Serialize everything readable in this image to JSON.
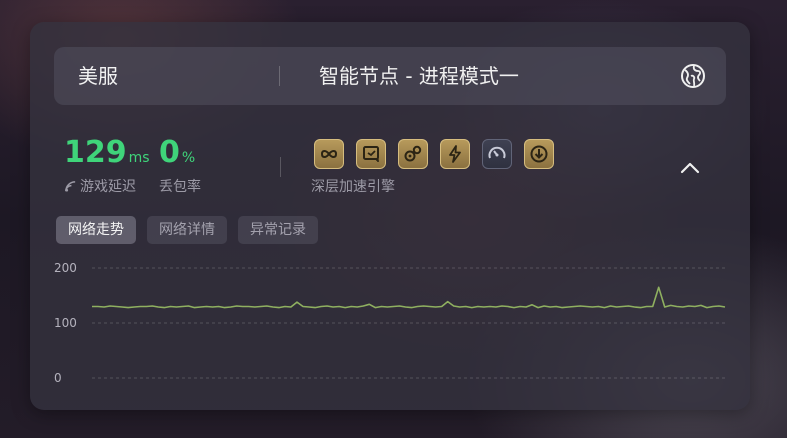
{
  "header": {
    "region": "美服",
    "node": "智能节点 - 进程模式一",
    "globe_icon": "globe-icon"
  },
  "stats": {
    "ping_value": "129",
    "ping_unit": "ms",
    "ping_label": "游戏延迟",
    "loss_value": "0",
    "loss_unit": "%",
    "loss_label": "丢包率"
  },
  "engine": {
    "label": "深层加速引擎",
    "icons": [
      {
        "name": "link-icon",
        "active": true
      },
      {
        "name": "screen-icon",
        "active": true
      },
      {
        "name": "gears-icon",
        "active": true
      },
      {
        "name": "lightning-icon",
        "active": true
      },
      {
        "name": "speedometer-icon",
        "active": false
      },
      {
        "name": "download-icon",
        "active": true
      }
    ]
  },
  "tabs": [
    {
      "label": "网络走势",
      "active": true
    },
    {
      "label": "网络详情",
      "active": false
    },
    {
      "label": "异常记录",
      "active": false
    }
  ],
  "colors": {
    "accent_green": "#3fd47a",
    "line_color": "#8fb060",
    "gold": "#b79a5c"
  },
  "chart_data": {
    "type": "line",
    "ylim": [
      0,
      200
    ],
    "y_ticks": [
      "200",
      "100",
      "0"
    ],
    "grid": true,
    "series": [
      {
        "values": [
          130,
          130,
          129,
          131,
          130,
          129,
          128,
          129,
          130,
          130,
          131,
          129,
          128,
          130,
          129,
          130,
          131,
          128,
          129,
          130,
          129,
          130,
          128,
          129,
          131,
          130,
          130,
          129,
          130,
          131,
          129,
          128,
          130,
          129,
          138,
          130,
          129,
          128,
          130,
          131,
          129,
          130,
          128,
          130,
          129,
          131,
          134,
          128,
          130,
          129,
          130,
          131,
          129,
          128,
          130,
          131,
          130,
          129,
          130,
          139,
          131,
          129,
          130,
          128,
          130,
          129,
          130,
          129,
          131,
          130,
          128,
          130,
          129,
          133,
          128,
          131,
          129,
          130,
          128,
          129,
          130,
          131,
          130,
          129,
          130,
          128,
          131,
          129,
          130,
          131,
          129,
          128,
          130,
          130,
          165,
          129,
          132,
          130,
          129,
          131,
          130,
          132,
          128,
          130,
          131,
          129
        ]
      }
    ]
  }
}
